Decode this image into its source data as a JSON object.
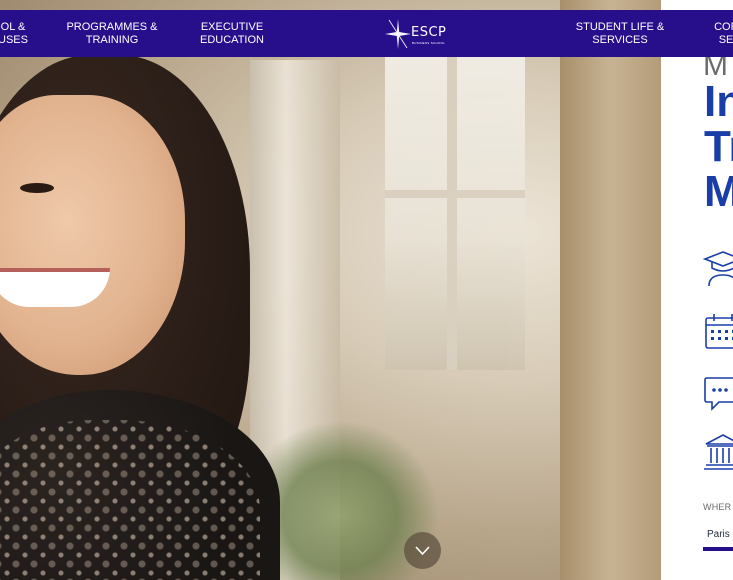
{
  "nav": {
    "items": [
      {
        "line1": "OL &",
        "line2": "USES"
      },
      {
        "line1": "PROGRAMMES &",
        "line2": "TRAINING"
      },
      {
        "line1": "EXECUTIVE",
        "line2": "EDUCATION"
      },
      {
        "line1": "STUDENT LIFE &",
        "line2": "SERVICES"
      },
      {
        "line1": "CORP",
        "line2": "SER"
      }
    ],
    "logo": {
      "word": "ESCP",
      "sub": "BUSINESS SCHOOL"
    }
  },
  "program": {
    "prefix": "M",
    "title_lines": [
      "In",
      "Tr",
      "M"
    ],
    "icons": [
      "graduate-icon",
      "calendar-icon",
      "chat-icon",
      "campus-building-icon"
    ],
    "where_label": "WHER",
    "city": "Paris"
  },
  "colors": {
    "nav_bg": "#270f8c",
    "title": "#1a3ea8",
    "icon": "#1a3ea8"
  },
  "hero": {
    "scroll_icon": "chevron-down-icon"
  }
}
